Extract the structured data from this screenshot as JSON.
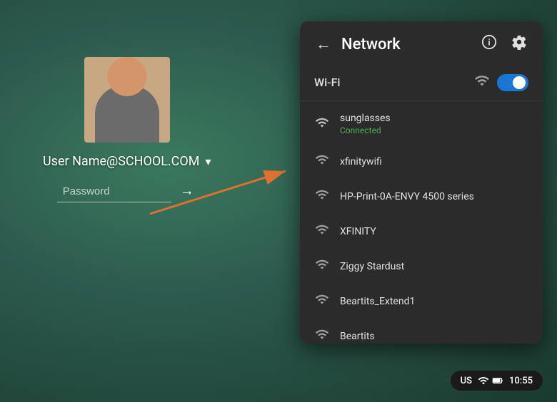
{
  "background": {
    "color": "#2d5a4e"
  },
  "login": {
    "username": "User Name@SCHOOL.COM",
    "password_placeholder": "Password",
    "chevron": "▾"
  },
  "network_panel": {
    "title": "Network",
    "back_icon": "←",
    "info_icon": "ⓘ",
    "settings_icon": "⚙",
    "wifi_section": {
      "label": "Wi-Fi",
      "toggle_on": true
    },
    "networks": [
      {
        "name": "sunglasses",
        "status": "Connected",
        "connected": true,
        "signal": 4
      },
      {
        "name": "xfinitywifi",
        "status": "",
        "connected": false,
        "signal": 3
      },
      {
        "name": "HP-Print-0A-ENVY 4500 series",
        "status": "",
        "connected": false,
        "signal": 2
      },
      {
        "name": "XFINITY",
        "status": "",
        "connected": false,
        "signal": 3
      },
      {
        "name": "Ziggy Stardust",
        "status": "",
        "connected": false,
        "signal": 3
      },
      {
        "name": "Beartits_Extend1",
        "status": "",
        "connected": false,
        "signal": 2
      },
      {
        "name": "Beartits",
        "status": "",
        "connected": false,
        "signal": 2
      }
    ]
  },
  "statusbar": {
    "region": "US",
    "wifi_icon": "▾",
    "time": "10:55",
    "battery": "█"
  }
}
